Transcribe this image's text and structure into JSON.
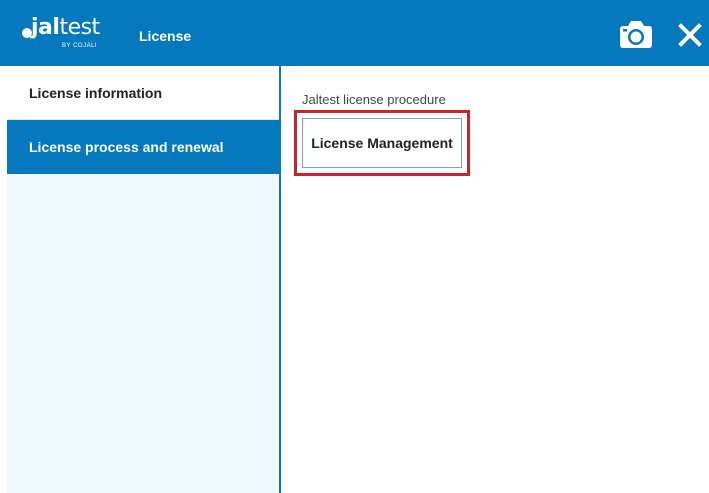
{
  "header": {
    "logo_text_bold": "jal",
    "logo_text_light": "test",
    "logo_subtext": "BY COJALI",
    "title": "License",
    "camera_icon": "camera-icon",
    "close_icon": "close-icon"
  },
  "sidebar": {
    "items": [
      {
        "label": "License information",
        "active": false
      },
      {
        "label": "License process and renewal",
        "active": true
      }
    ]
  },
  "main": {
    "section_label": "Jaltest license procedure",
    "button_label": "License Management"
  },
  "colors": {
    "primary_blue": "#0678bd",
    "sidebar_bg": "#f0f9fe",
    "highlight_red": "#c8242b",
    "button_border": "#6aa8c7"
  }
}
